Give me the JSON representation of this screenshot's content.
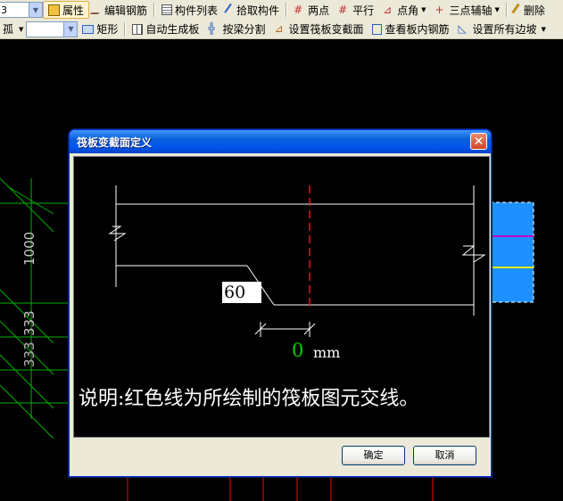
{
  "toolbar1": {
    "combo_value": "3",
    "items": [
      "属性",
      "编辑钢筋",
      "构件列表",
      "拾取构件",
      "两点",
      "平行",
      "点角",
      "三点辅轴",
      "删除"
    ]
  },
  "toolbar2": {
    "combo_left_text": "孤",
    "combo_value": "",
    "items": [
      "矩形",
      "自动生成板",
      "按梁分割",
      "设置筏板变截面",
      "查看板内钢筋",
      "设置所有边坡"
    ]
  },
  "background": {
    "dims": [
      "1000",
      "333",
      "333",
      "333"
    ],
    "colors": {
      "guide": "#00b000",
      "slab": "#1e90ff",
      "cut_line": "#ff0000"
    }
  },
  "dialog": {
    "title": "筏板变截面定义",
    "close_symbol": "✕",
    "dimension_value": "60",
    "offset_value": "0",
    "unit": "mm",
    "note": "说明:红色线为所绘制的筏板图元交线。",
    "ok_label": "确定",
    "cancel_label": "取消"
  }
}
